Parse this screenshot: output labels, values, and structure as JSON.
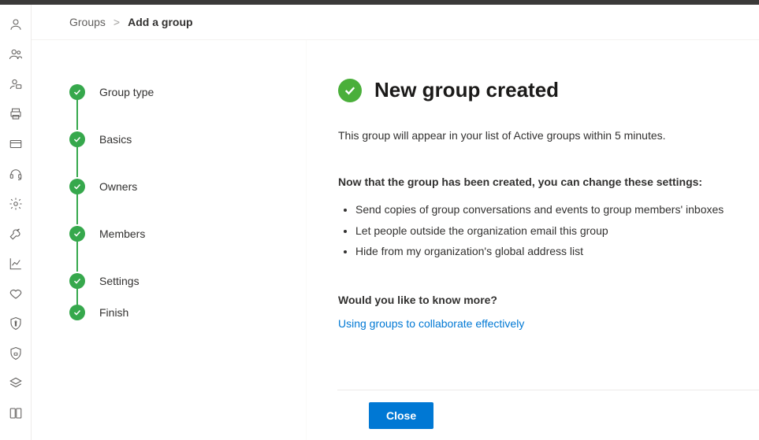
{
  "breadcrumb": {
    "root": "Groups",
    "separator": ">",
    "current": "Add a group"
  },
  "steps": [
    {
      "label": "Group type"
    },
    {
      "label": "Basics"
    },
    {
      "label": "Owners"
    },
    {
      "label": "Members"
    },
    {
      "label": "Settings"
    },
    {
      "label": "Finish"
    }
  ],
  "result": {
    "heading": "New group created",
    "subtext": "This group will appear in your list of Active groups within 5 minutes.",
    "settings_intro": "Now that the group has been created, you can change these settings:",
    "settings_items": [
      "Send copies of group conversations and events to group members' inboxes",
      "Let people outside the organization email this group",
      "Hide from my organization's global address list"
    ],
    "more_heading": "Would you like to know more?",
    "more_link": "Using groups to collaborate effectively"
  },
  "footer": {
    "close_label": "Close"
  },
  "rail_icons": [
    "user-icon",
    "people-icon",
    "user-tag-icon",
    "printer-icon",
    "card-icon",
    "headset-icon",
    "gear-icon",
    "wrench-icon",
    "chart-icon",
    "heart-icon",
    "shield-info-icon",
    "shield-lock-icon",
    "stack-icon",
    "dual-icon"
  ]
}
